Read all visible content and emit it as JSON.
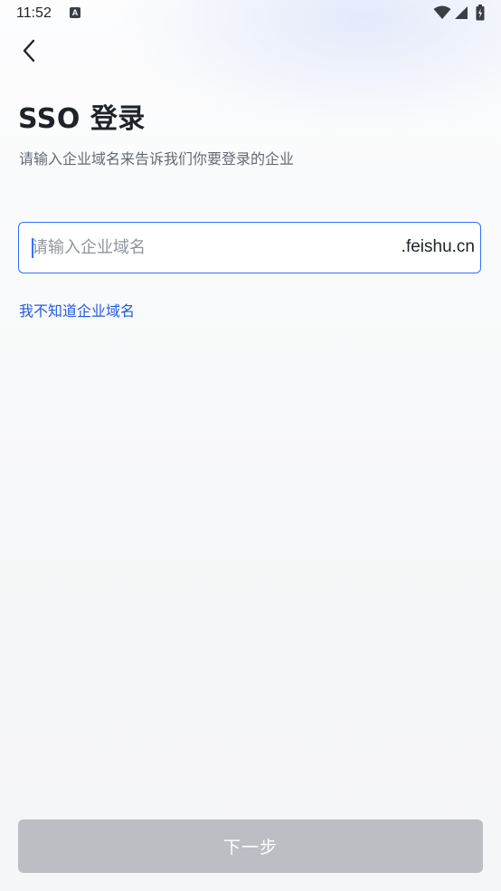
{
  "status_bar": {
    "time": "11:52",
    "notification_icon_letter": "A",
    "icons": [
      "wifi-icon",
      "signal-icon",
      "battery-icon"
    ]
  },
  "header": {
    "back_icon": "chevron-left-icon",
    "title": "SSO 登录",
    "subtitle": "请输入企业域名来告诉我们你要登录的企业"
  },
  "domain_field": {
    "value": "",
    "placeholder": "请输入企业域名",
    "suffix": ".feishu.cn"
  },
  "help_link": "我不知道企业域名",
  "next_button": {
    "label": "下一步",
    "enabled": false
  },
  "colors": {
    "accent": "#3370ff",
    "link": "#245bdb",
    "text_primary": "#1f2329",
    "text_secondary": "#646a73",
    "disabled_button": "#bbbfc4"
  }
}
